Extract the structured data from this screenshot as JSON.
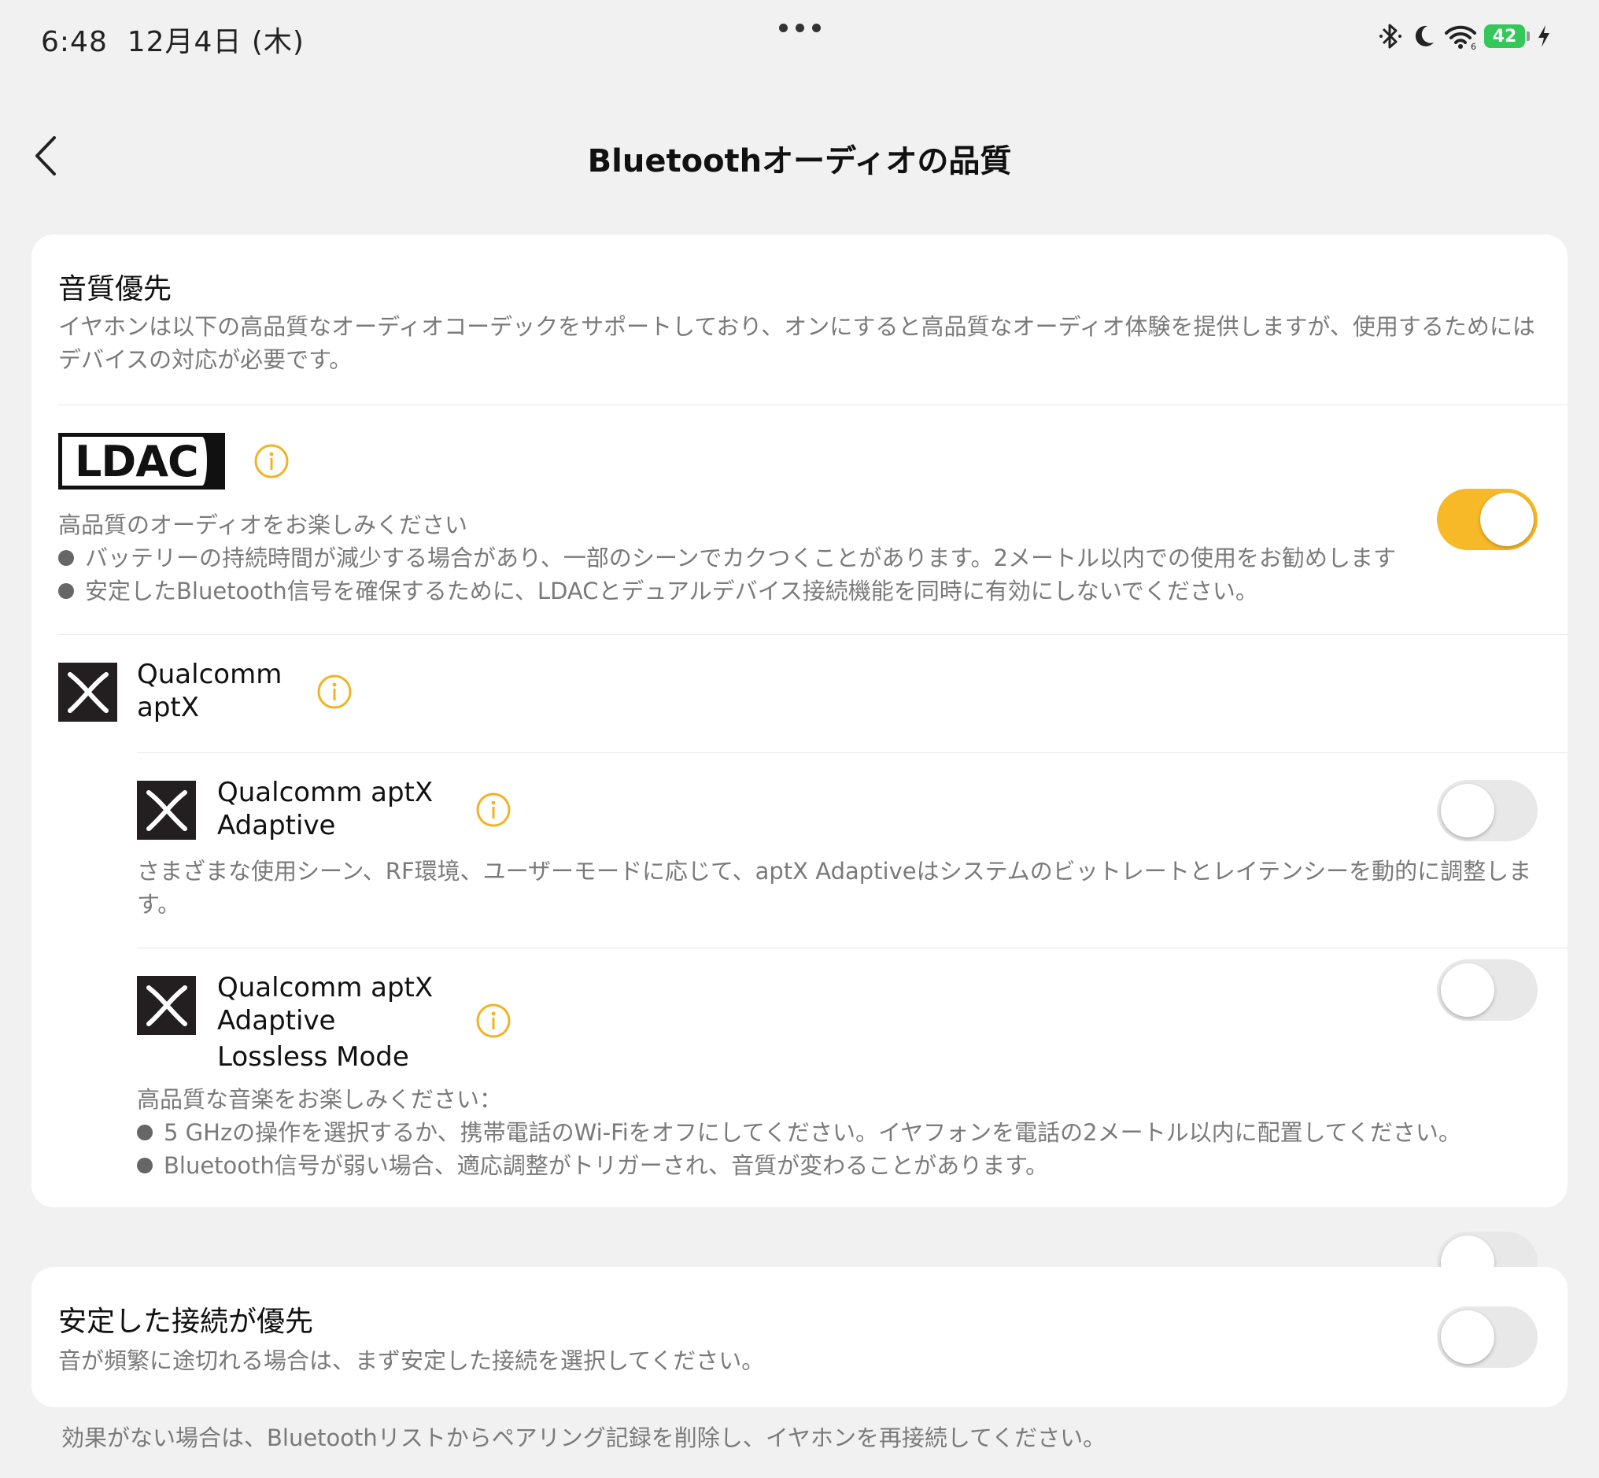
{
  "status_bar": {
    "time": "6:48",
    "date": "12月4日 (木)",
    "battery": "42",
    "accent_battery": "#34c759"
  },
  "nav": {
    "title": "Bluetoothオーディオの品質",
    "back_icon": "chevron-left-icon"
  },
  "quality_section": {
    "title": "音質優先",
    "description_line1": "イヤホンは以下の高品質なオーディオコーデックをサポートしており、オンにすると高品質なオーディオ体験を提供しますが、使用するためには",
    "description_line2": "デバイスの対応が必要です。"
  },
  "ldac": {
    "logo_text": "LDAC",
    "enabled": true,
    "subtitle": "高品質のオーディオをお楽しみください",
    "bullets": [
      "バッテリーの持続時間が減少する場合があり、一部のシーンでカクつくことがあります。2メートル以内での使用をお勧めします",
      "安定したBluetooth信号を確保するために、LDACとデュアルデバイス接続機能を同時に有効にしないでください。"
    ]
  },
  "aptx": {
    "line1": "Qualcomm",
    "line2": "aptX",
    "enabled": false
  },
  "aptx_adaptive": {
    "line1": "Qualcomm aptX",
    "line2": "Adaptive",
    "enabled": false,
    "description_line1": "さまざまな使用シーン、RF環境、ユーザーモードに応じて、aptX Adaptiveはシステムのビットレートとレイテンシーを動的に調整しま",
    "description_line2": "す。"
  },
  "aptx_lossless": {
    "line1": "Qualcomm aptX",
    "line2": "Adaptive",
    "line3": "Lossless Mode",
    "enabled": false,
    "subtitle": "高品質な音楽をお楽しみください：",
    "bullets": [
      "5 GHzの操作を選択するか、携帯電話のWi-Fiをオフにしてください。イヤフォンを電話の2メートル以内に配置してください。",
      "Bluetooth信号が弱い場合、適応調整がトリガーされ、音質が変わることがあります。"
    ]
  },
  "stable_section": {
    "title": "安定した接続が優先",
    "description": "音が頻繁に途切れる場合は、まず安定した接続を選択してください。",
    "enabled": false
  },
  "footer_note": "効果がない場合は、Bluetoothリストからペアリング記録を削除し、イヤホンを再接続してください。",
  "colors": {
    "toggle_on": "#f7b928",
    "info_icon": "#f0b323",
    "background": "#f1f1f2"
  }
}
